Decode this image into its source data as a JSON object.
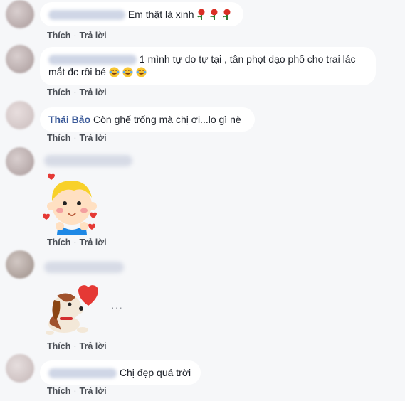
{
  "comments": [
    {
      "text": "Em thật là xinh",
      "emoji": [
        "rose-icon",
        "rose-icon",
        "rose-icon"
      ]
    },
    {
      "text": "1 mình tự do tự tại , tân phọt dạo phố cho trai lác mắt đc rồi bé",
      "emoji": [
        "laughing-tears-icon",
        "laughing-tears-icon",
        "laughing-tears-icon"
      ]
    },
    {
      "author": "Thái Bảo",
      "text": "Còn ghế trống mà chị ơi...lo gì nè"
    },
    {
      "sticker": "boy-with-hearts-sticker"
    },
    {
      "sticker": "puppy-with-heart-sticker",
      "more": "···"
    },
    {
      "text": "Chị đẹp quá trời"
    }
  ],
  "actions": {
    "like": "Thích",
    "reply": "Trả lời",
    "separator": "·"
  },
  "colors": {
    "background": "#f6f7f9",
    "bubble": "#ffffff",
    "author": "#385898",
    "action": "#4b4f56"
  }
}
